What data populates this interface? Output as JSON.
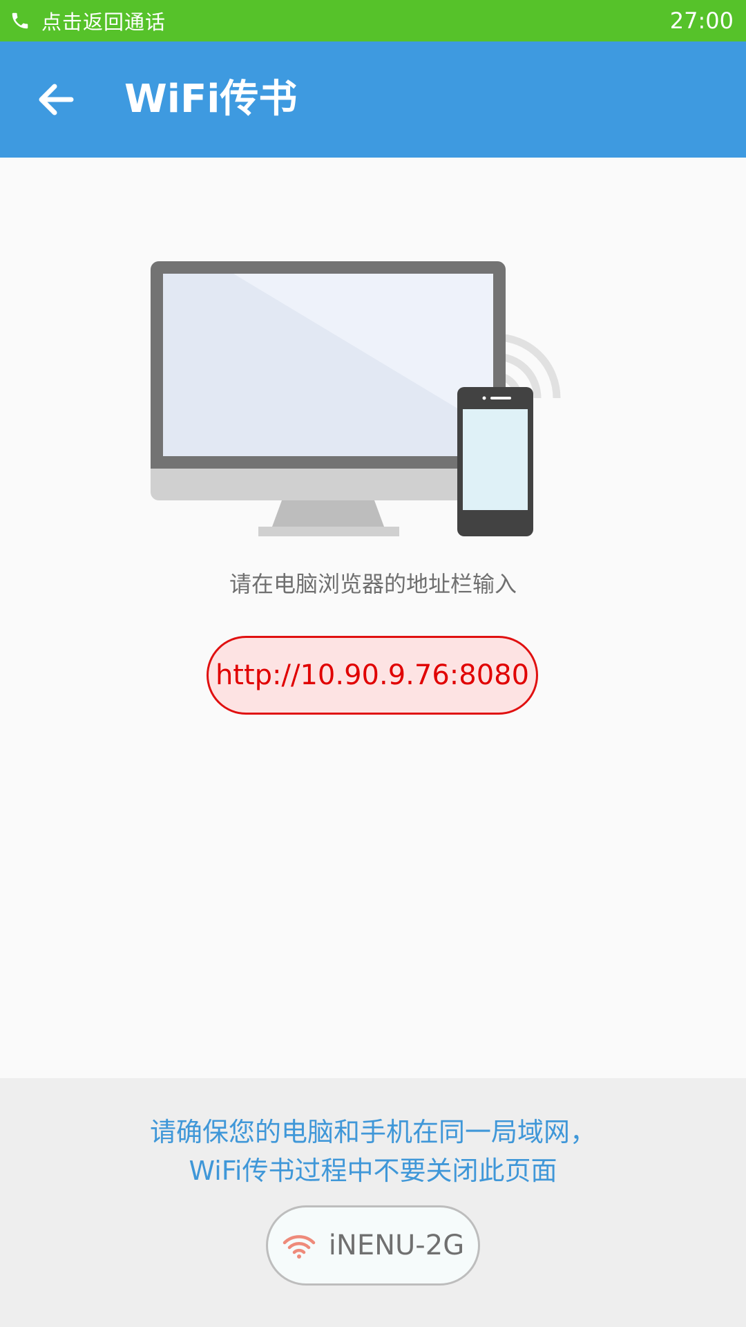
{
  "status_bar": {
    "call_text": "点击返回通话",
    "time": "27:00",
    "background": "#56c22a"
  },
  "app_bar": {
    "title": "WiFi传书",
    "background": "#3e9ae0",
    "back_icon": "arrow-left-icon"
  },
  "main": {
    "illustration": "computer-and-phone-wifi",
    "instruction": "请在电脑浏览器的地址栏输入",
    "url": "http://10.90.9.76:8080",
    "url_color": "#e00000"
  },
  "bottom": {
    "notice_line1": "请确保您的电脑和手机在同一局域网，",
    "notice_line2": "WiFi传书过程中不要关闭此页面",
    "network_name": "iNENU-2G",
    "network_icon": "wifi-icon",
    "notice_color": "#3f97d8"
  }
}
